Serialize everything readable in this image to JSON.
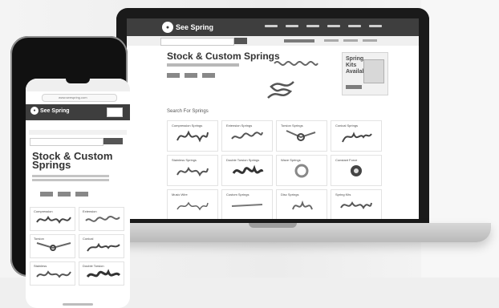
{
  "laptop": {
    "site_logo": "See Spring",
    "hero_title": "Stock & Custom Springs",
    "promo_title": "Spring Kits Available!",
    "section_title": "Search For Springs",
    "cards": [
      {
        "label": "Compression Springs",
        "icon": "compression-spring-icon"
      },
      {
        "label": "Extension Springs",
        "icon": "extension-spring-icon"
      },
      {
        "label": "Torsion Springs",
        "icon": "torsion-spring-icon"
      },
      {
        "label": "Conical Springs",
        "icon": "conical-spring-icon"
      },
      {
        "label": "Stainless Springs",
        "icon": "stainless-spring-icon"
      },
      {
        "label": "Double Torsion Springs",
        "icon": "double-torsion-spring-icon"
      },
      {
        "label": "Wave Springs",
        "icon": "wave-spring-icon"
      },
      {
        "label": "Constant Force",
        "icon": "constant-force-spring-icon"
      },
      {
        "label": "Music Wire",
        "icon": "music-wire-spring-icon"
      },
      {
        "label": "Custom Springs",
        "icon": "custom-spring-icon"
      },
      {
        "label": "Disc Springs",
        "icon": "disc-spring-icon"
      },
      {
        "label": "Spring Kits",
        "icon": "spring-kit-icon"
      }
    ]
  },
  "phone": {
    "url_text": "www.seespring.com",
    "site_logo": "See Spring",
    "title_line1": "Stock & Custom",
    "title_line2": "Springs",
    "cards": [
      {
        "label": "Compression",
        "icon": "compression-spring-icon"
      },
      {
        "label": "Extension",
        "icon": "extension-spring-icon"
      },
      {
        "label": "Torsion",
        "icon": "torsion-spring-icon"
      },
      {
        "label": "Conical",
        "icon": "conical-spring-icon"
      },
      {
        "label": "Stainless",
        "icon": "stainless-spring-icon"
      },
      {
        "label": "Double Torsion",
        "icon": "double-torsion-spring-icon"
      }
    ]
  },
  "colors": {
    "header": "#3e3e3e",
    "accent": "#555555",
    "background": "#efefef"
  }
}
